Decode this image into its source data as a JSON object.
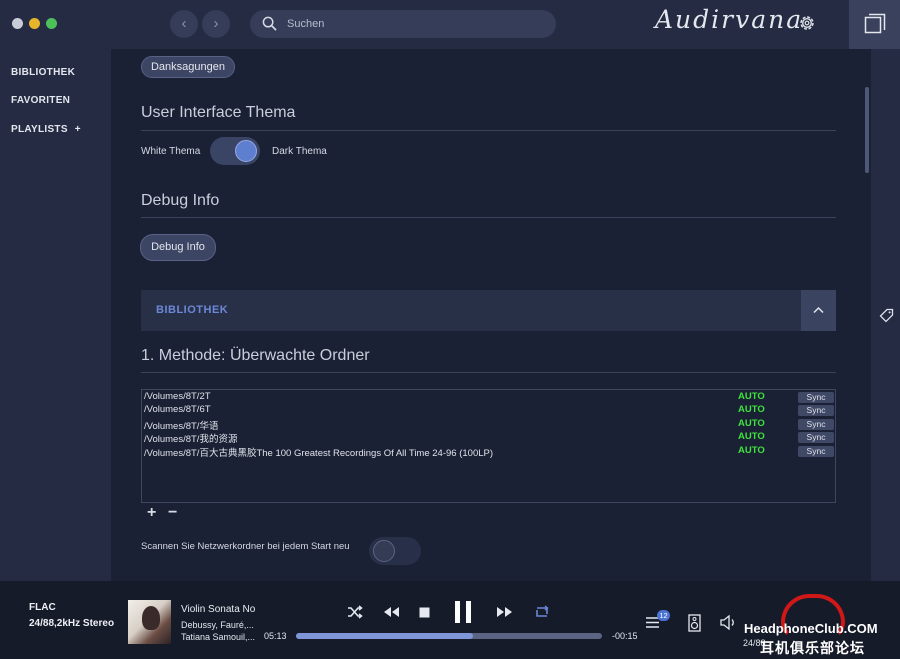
{
  "titlebar": {
    "back_label": "‹",
    "forward_label": "›",
    "search_placeholder": "Suchen",
    "logo": "Audirvana"
  },
  "sidebar": {
    "items": [
      {
        "label": "BIBLIOTHEK"
      },
      {
        "label": "FAVORITEN"
      },
      {
        "label": "PLAYLISTS"
      }
    ],
    "playlists_add": "+"
  },
  "settings": {
    "credits_button": "Danksagungen",
    "ui_theme": {
      "title": "User Interface Thema",
      "left_label": "White Thema",
      "right_label": "Dark Thema",
      "dark_enabled": true
    },
    "debug": {
      "title": "Debug Info",
      "button": "Debug Info"
    },
    "library": {
      "header": "BIBLIOTHEK",
      "method_title": "1. Methode: Überwachte Ordner",
      "folders": [
        {
          "path": "/Volumes/8T/2T",
          "mode": "AUTO",
          "action": "Sync"
        },
        {
          "path": "/Volumes/8T/6T",
          "mode": "AUTO",
          "action": "Sync"
        },
        {
          "path": "/Volumes/8T/华语",
          "mode": "AUTO",
          "action": "Sync"
        },
        {
          "path": "/Volumes/8T/我的资源",
          "mode": "AUTO",
          "action": "Sync"
        },
        {
          "path": "/Volumes/8T/百大古典黑胶The 100 Greatest Recordings Of All Time 24-96 (100LP)",
          "mode": "AUTO",
          "action": "Sync"
        }
      ],
      "add_label": "+",
      "remove_label": "−",
      "scan_network_label": "Scannen Sie Netzwerkordner bei jedem Start neu",
      "scan_network_enabled": false
    }
  },
  "player": {
    "format": "FLAC",
    "format_detail": "24/88,2kHz Stereo",
    "track_title": "Violin Sonata No",
    "track_composers": "Debussy, Fauré,...",
    "track_artists": "Tatiana Samouil,...",
    "elapsed": "05:13",
    "remaining": "-00:15",
    "progress_fraction": 0.58,
    "queue_count": "12",
    "watermark_brand": "HeadphoneClub.COM",
    "watermark_cn": "耳机俱乐部论坛",
    "device_partial": "24/88"
  },
  "colors": {
    "background": "#1b2134",
    "sidebar": "#242b42",
    "accent": "#6b88d8",
    "auto_green": "#3fe23f",
    "player_bg": "#161b2a"
  }
}
